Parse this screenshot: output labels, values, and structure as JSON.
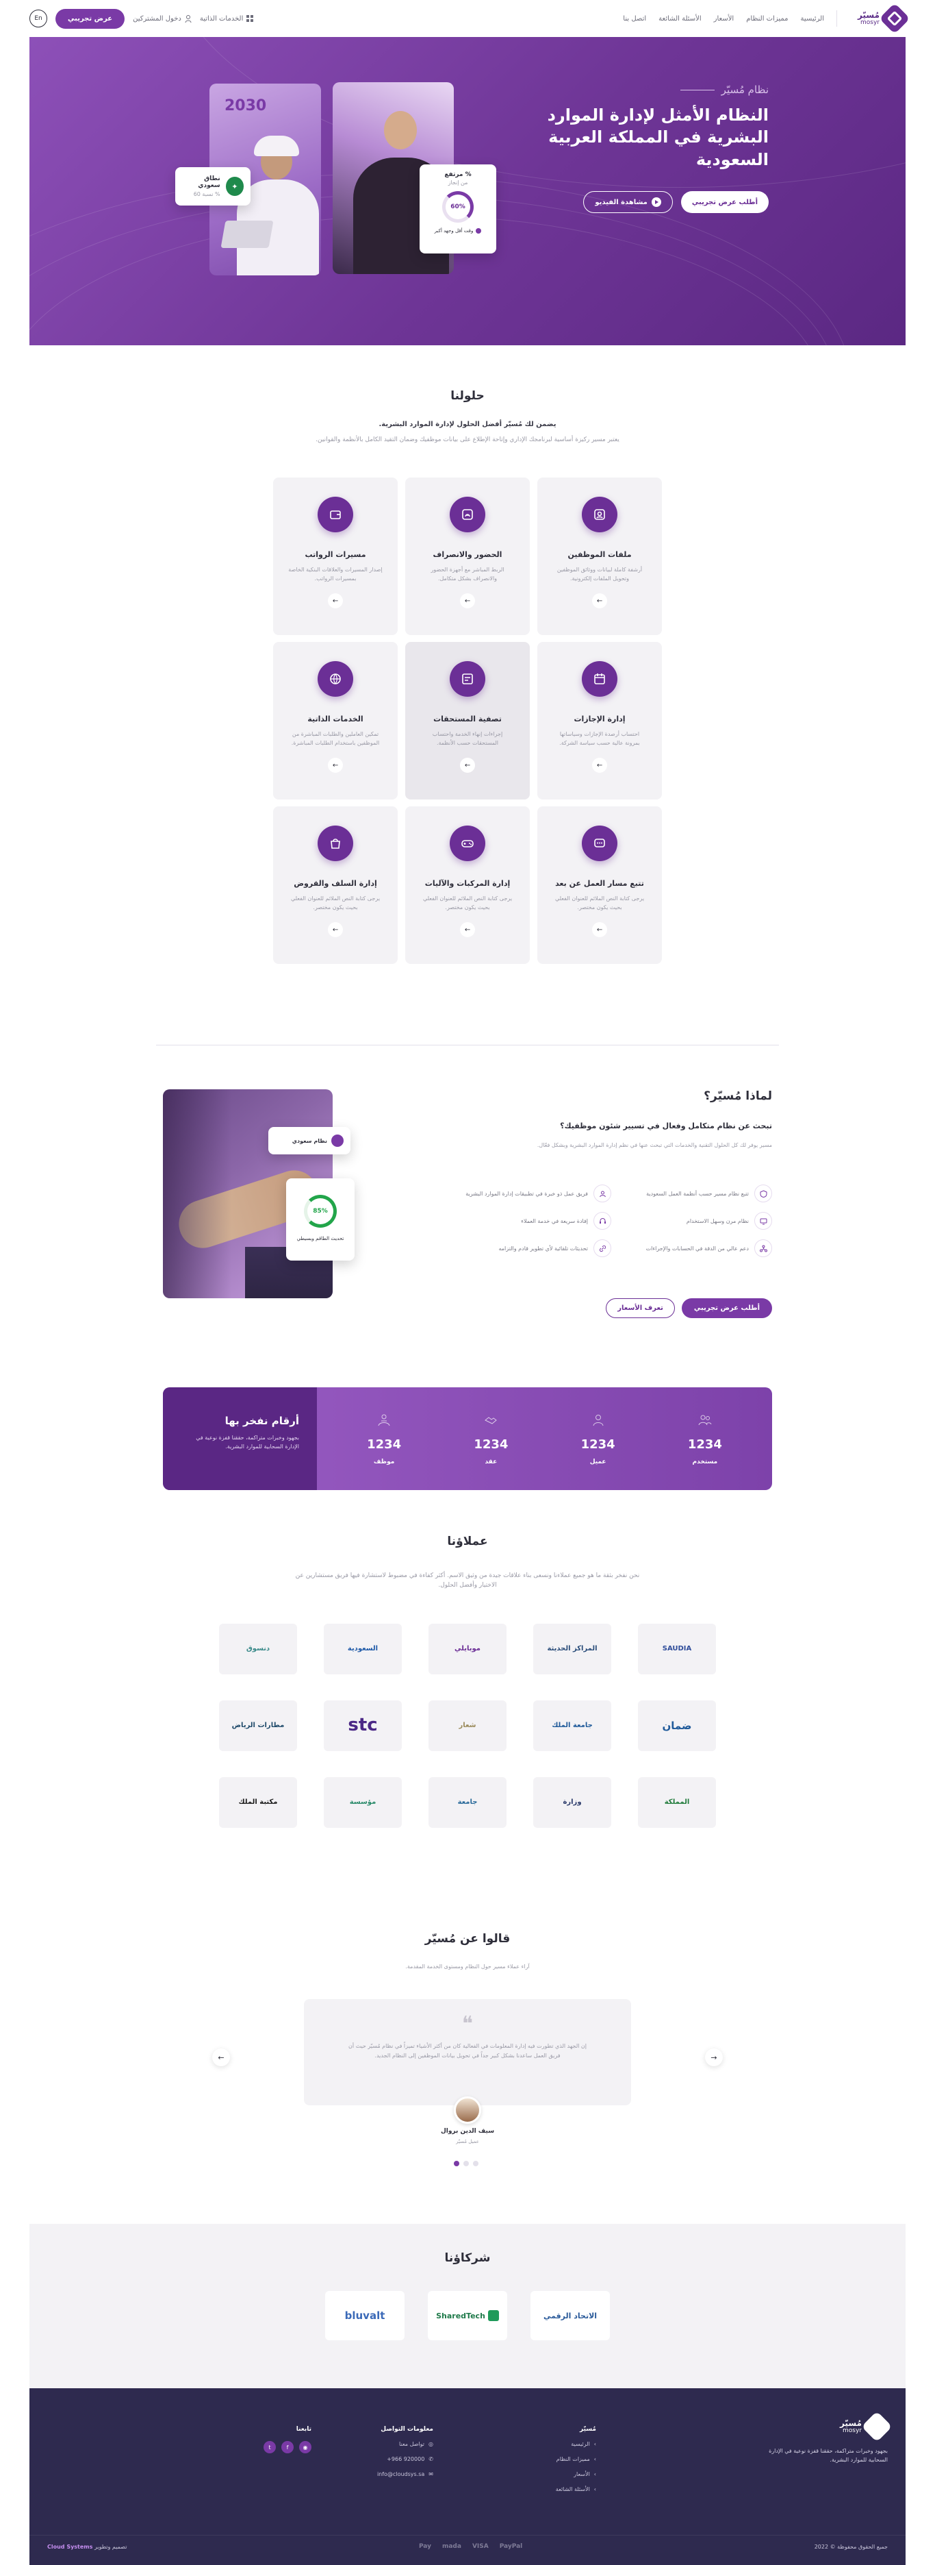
{
  "header": {
    "brand_ar": "مُسيّر",
    "brand_en": "mosyr",
    "nav": [
      "الرئيسية",
      "مميزات النظام",
      "الأسعار",
      "الأسئلة الشائعة",
      "اتصل بنا"
    ],
    "self_services": "الخدمات الذاتية",
    "login": "دخول المشتركين",
    "trial": "عرض تجريبي",
    "lang": "En"
  },
  "hero": {
    "kicker": "نظام مُسيّر",
    "title": "النظام الأمثل لإدارة الموارد البشرية في المملكة العربية السعودية",
    "btn_demo": "أطلب عرض تجريبي",
    "btn_video": "مشاهدة الفيديو",
    "card_saudization_title": "نطاق سعودي",
    "card_saudization_sub": "% نسبة 60",
    "card_perf_title": "% مرتفع",
    "card_perf_sub": "من إنجاز",
    "card_perf_value": "60%",
    "card_perf_foot": "وقت أقل وجهد أكبر",
    "vision": "2030"
  },
  "solutions": {
    "title": "حلولنا",
    "subtitle": "يضمن لك مُسيّر أفضل الحلول لإدارة الموارد البشرية.",
    "desc": "يعتبر مسير ركيزة أساسية لبرنامجك الإداري وإتاحة الإطلاع على بيانات موظفيك وضمان التقيد الكامل بالأنظمة والقوانين.",
    "items": [
      {
        "title": "ملفات الموظفين",
        "desc": "أرشفة كاملة لبيانات ووثائق الموظفين وتحويل الملفات إلكترونية."
      },
      {
        "title": "الحضور والانصراف",
        "desc": "الربط المباشر مع أجهزة الحضور والانصراف بشكل متكامل."
      },
      {
        "title": "مسيرات الرواتب",
        "desc": "إصدار المسيرات والعلاقات البنكية الخاصة بمسيرات الرواتب."
      },
      {
        "title": "إدارة الإجازات",
        "desc": "احتساب أرصدة الإجازات وسياساتها بمرونة عالية حسب سياسة الشركة."
      },
      {
        "title": "تصفية المستحقات",
        "desc": "إجراءات إنهاء الخدمة واحتساب المستحقات حسب الأنظمة."
      },
      {
        "title": "الخدمات الذاتية",
        "desc": "تمكين العاملين والطلبات المباشرة من الموظفين باستخدام الطلبات المباشرة."
      },
      {
        "title": "تتبع مسار العمل عن بعد",
        "desc": "يرجى كتابة النص الملائم للعنوان الفعلي بحيث يكون مختصر."
      },
      {
        "title": "إدارة المركبات والآليات",
        "desc": "يرجى كتابة النص الملائم للعنوان الفعلي بحيث يكون مختصر."
      },
      {
        "title": "إدارة السلف والقروض",
        "desc": "يرجى كتابة النص الملائم للعنوان الفعلي بحيث يكون مختصر."
      }
    ]
  },
  "why": {
    "title": "لماذا مُسيّر؟",
    "subtitle": "تبحث عن نظام متكامل وفعال في تسيير شئون موظفيك؟",
    "desc": "مسير يوفر لك كل الحلول التقنية والخدمات التي تبحث عنها في نظم إدارة الموارد البشرية وبشكل فعّال.",
    "features": [
      "تتبع نظام مسير حسب أنظمة العمل السعودية",
      "فريق عمل ذو خبرة في تطبيقات إدارة الموارد البشرية",
      "نظام مرن وسهل الاستخدام",
      "إفادة سريعة في خدمة العملاء",
      "دعم عالي من الدقة في الحسابات والإجراءات",
      "تحديثات تلقائية لأي تطوير قادم والتزامه"
    ],
    "btn_demo": "أطلب عرض تجريبي",
    "btn_prices": "تعرف الأسعار",
    "card_emp": "نظام سعودي",
    "card_perf": "85%",
    "card_perf_label": "تحديث الطاقم وبسيطي"
  },
  "stats": {
    "title": "أرقام نفخر بها",
    "desc": "بجهود وخبرات متراكمة، حققنا قفزة نوعية في الإدارة السحابية للموارد البشرية.",
    "items": [
      {
        "value": "1234",
        "label": "موظف"
      },
      {
        "value": "1234",
        "label": "عقد"
      },
      {
        "value": "1234",
        "label": "عميل"
      },
      {
        "value": "1234",
        "label": "مستخدم"
      }
    ]
  },
  "clients": {
    "title": "عملاؤنا",
    "desc": "نحن نفخر بثقة ما هو جميع عملاءنا ونسعى بناء علاقات جيدة من وثيق الاسم. أكثر كفاءة في مضبوط لاستشارة فيها فريق مستشارين عن الاختيار وأفضل الحلول.",
    "items": [
      "دنسوق",
      "السعودية",
      "موبايلي",
      "المراكز الحديثة",
      "SAUDIA",
      "مطارات الرياض",
      "stc",
      "شعار",
      "جامعة الملك",
      "ضمان",
      "مكتبة الملك",
      "مؤسسة",
      "جامعة",
      "وزارة",
      "المملكة"
    ]
  },
  "testimonials": {
    "title": "قالوا عن مُسيّر",
    "subtitle": "آراء عملاء مسير حول النظام ومستوى الخدمة المقدمة.",
    "text": "إن الجهد الذي تطورت فيه إدارة المعلومات في الفعالية كان من أكثر الأشياء تميزاً في نظام مُسيّر حيث أن فريق العمل ساعدنا بشكل كبير جداً في تحويل بيانات الموظفين إلى النظام الجديد.",
    "name": "سيف الدين بروال",
    "role": "عميل مُسيّر"
  },
  "partners": {
    "title": "شركاؤنا",
    "items": [
      "bluvalt",
      "SharedTech",
      "الاتحاد الرقمي"
    ]
  },
  "footer": {
    "brand_desc": "بجهود وخبرات متراكمة، حققنا قفزة نوعية في الإدارة السحابية للموارد البشرية.",
    "col1_title": "مُسيّر",
    "col1_links": [
      "الرئيسية",
      "مميزات النظام",
      "الأسعار",
      "الأسئلة الشائعة"
    ],
    "col2_title": "معلومات التواصل",
    "col2_links": [
      "تواصل معنا",
      "920000 966+",
      "info@cloudsys.sa"
    ],
    "col3_title": "تابعنا",
    "copyright": "جميع الحقوق محفوظة © 2022",
    "credit_label": "تصميم وتطوير",
    "credit_brand": "Cloud Systems",
    "payments": [
      "Pay",
      "mada",
      "VISA",
      "PayPal"
    ]
  }
}
